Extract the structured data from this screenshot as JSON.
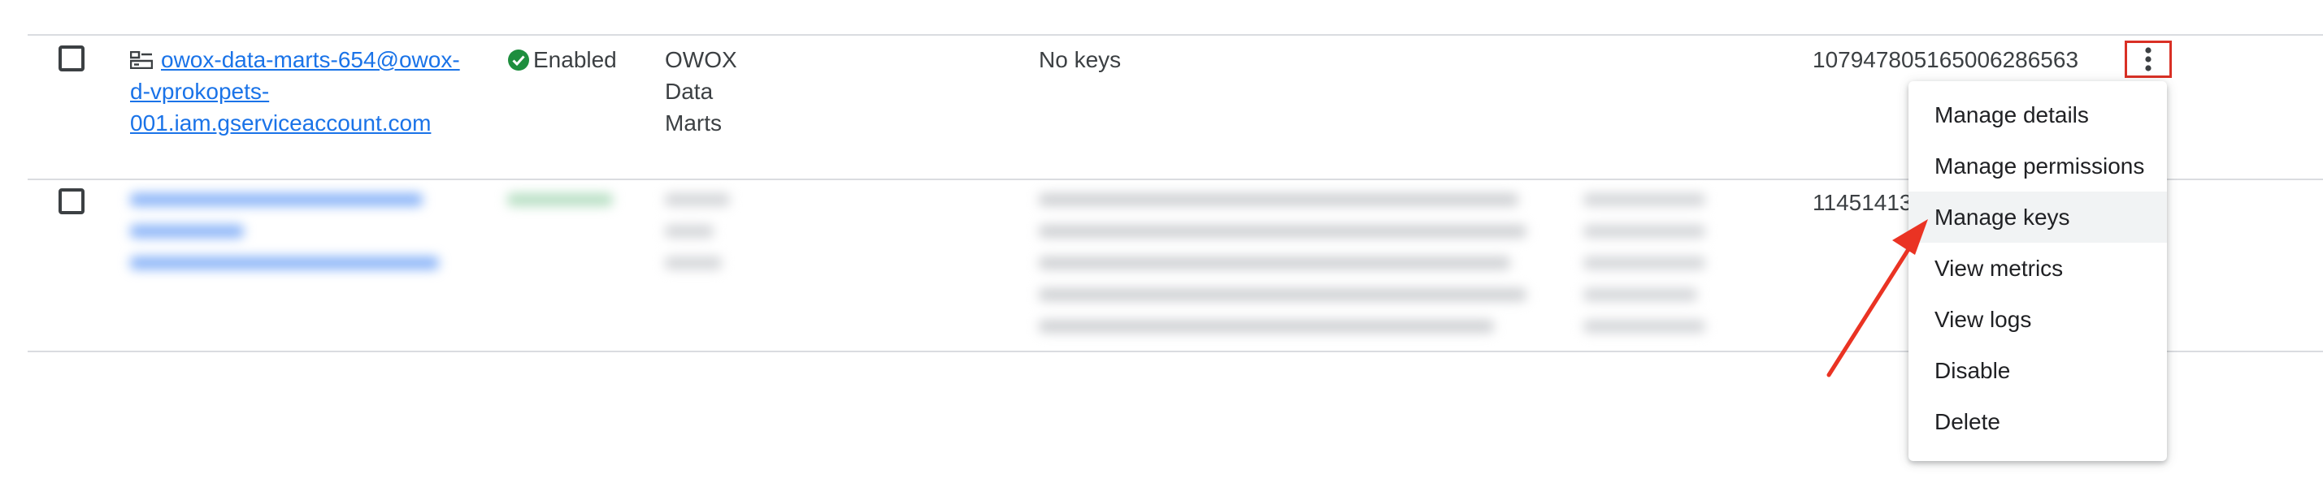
{
  "rows": [
    {
      "email_line1": "owox-data-marts-654@owox-",
      "email_line2": "d-vprokopets-",
      "email_line3": "001.iam.gserviceaccount.com",
      "status": "Enabled",
      "name_lines": [
        "OWOX",
        "Data",
        "Marts"
      ],
      "keys": "No keys",
      "oauth_client_id": "107947805165006286563"
    },
    {
      "oauth_client_id_partial": "11451413"
    }
  ],
  "menu": {
    "items": [
      "Manage details",
      "Manage permissions",
      "Manage keys",
      "View metrics",
      "View logs",
      "Disable",
      "Delete"
    ],
    "hovered": "Manage keys"
  },
  "colors": {
    "link": "#1a73e8",
    "enabled_green": "#1e8e3e",
    "highlight_red": "#d93025",
    "divider": "#dadce0"
  },
  "icons": {
    "service_account": "service-account-icon",
    "status": "check-circle-icon",
    "more": "more-vert-icon"
  }
}
